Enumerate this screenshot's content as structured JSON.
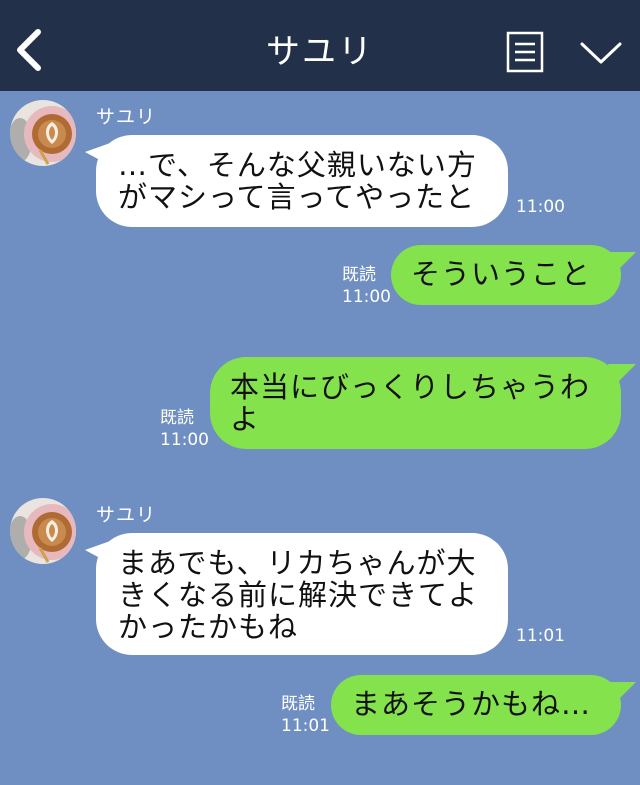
{
  "header": {
    "title": "サユリ"
  },
  "messages": [
    {
      "side": "in",
      "sender": "サユリ",
      "text": "…で、そんな父親いない方\nがマシって言ってやったと",
      "time": "11:00"
    },
    {
      "side": "out",
      "read": "既読",
      "text": "そういうこと",
      "time": "11:00"
    },
    {
      "side": "out",
      "read": "既読",
      "text": "本当にびっくりしちゃうわ\nよ",
      "time": "11:00"
    },
    {
      "side": "in",
      "sender": "サユリ",
      "text": "まあでも、リカちゃんが大\nきくなる前に解決できてよ\nかったかもね",
      "time": "11:01"
    },
    {
      "side": "out",
      "read": "既読",
      "text": "まあそうかもね…",
      "time": "11:01"
    }
  ],
  "colors": {
    "background": "#6f8fc2",
    "header": "#22304a",
    "incoming": "#ffffff",
    "outgoing": "#84e24c"
  },
  "icons": {
    "back": "chevron-left-icon",
    "menu": "document-lines-icon",
    "collapse": "chevron-down-icon",
    "avatar": "latte-art-avatar"
  }
}
